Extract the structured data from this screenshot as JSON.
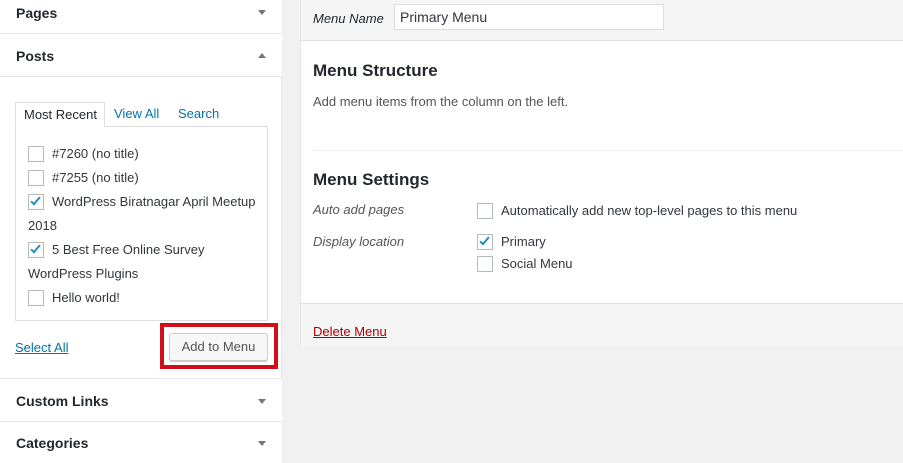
{
  "accordion": {
    "pages": {
      "title": "Pages"
    },
    "posts": {
      "title": "Posts"
    },
    "custom_links": {
      "title": "Custom Links"
    },
    "categories": {
      "title": "Categories"
    }
  },
  "posts_tabs": [
    "Most Recent",
    "View All",
    "Search"
  ],
  "posts_items": [
    {
      "label_lines": [
        "#7260 (no title)"
      ],
      "checked": false
    },
    {
      "label_lines": [
        "#7255 (no title)"
      ],
      "checked": false
    },
    {
      "label_lines": [
        "WordPress Biratnagar April Meetup",
        "2018"
      ],
      "checked": true
    },
    {
      "label_lines": [
        "5 Best Free Online Survey",
        "WordPress Plugins"
      ],
      "checked": true
    },
    {
      "label_lines": [
        "Hello world!"
      ],
      "checked": false
    }
  ],
  "posts_actions": {
    "select_all": "Select All",
    "add_to_menu": "Add to Menu"
  },
  "menu": {
    "name_label": "Menu Name",
    "name_value": "Primary Menu",
    "structure_title": "Menu Structure",
    "structure_desc": "Add menu items from the column on the left.",
    "settings_title": "Menu Settings",
    "auto_add_label": "Auto add pages",
    "auto_add_option": {
      "label": "Automatically add new top-level pages to this menu",
      "checked": false
    },
    "display_location_label": "Display location",
    "locations": [
      {
        "label": "Primary",
        "checked": true
      },
      {
        "label": "Social Menu",
        "checked": false
      }
    ],
    "delete_label": "Delete Menu"
  },
  "colors": {
    "link": "#0073aa",
    "delete": "#aa0000",
    "highlight_border": "#d10f1a",
    "checkmark": "#1e8cbe"
  }
}
